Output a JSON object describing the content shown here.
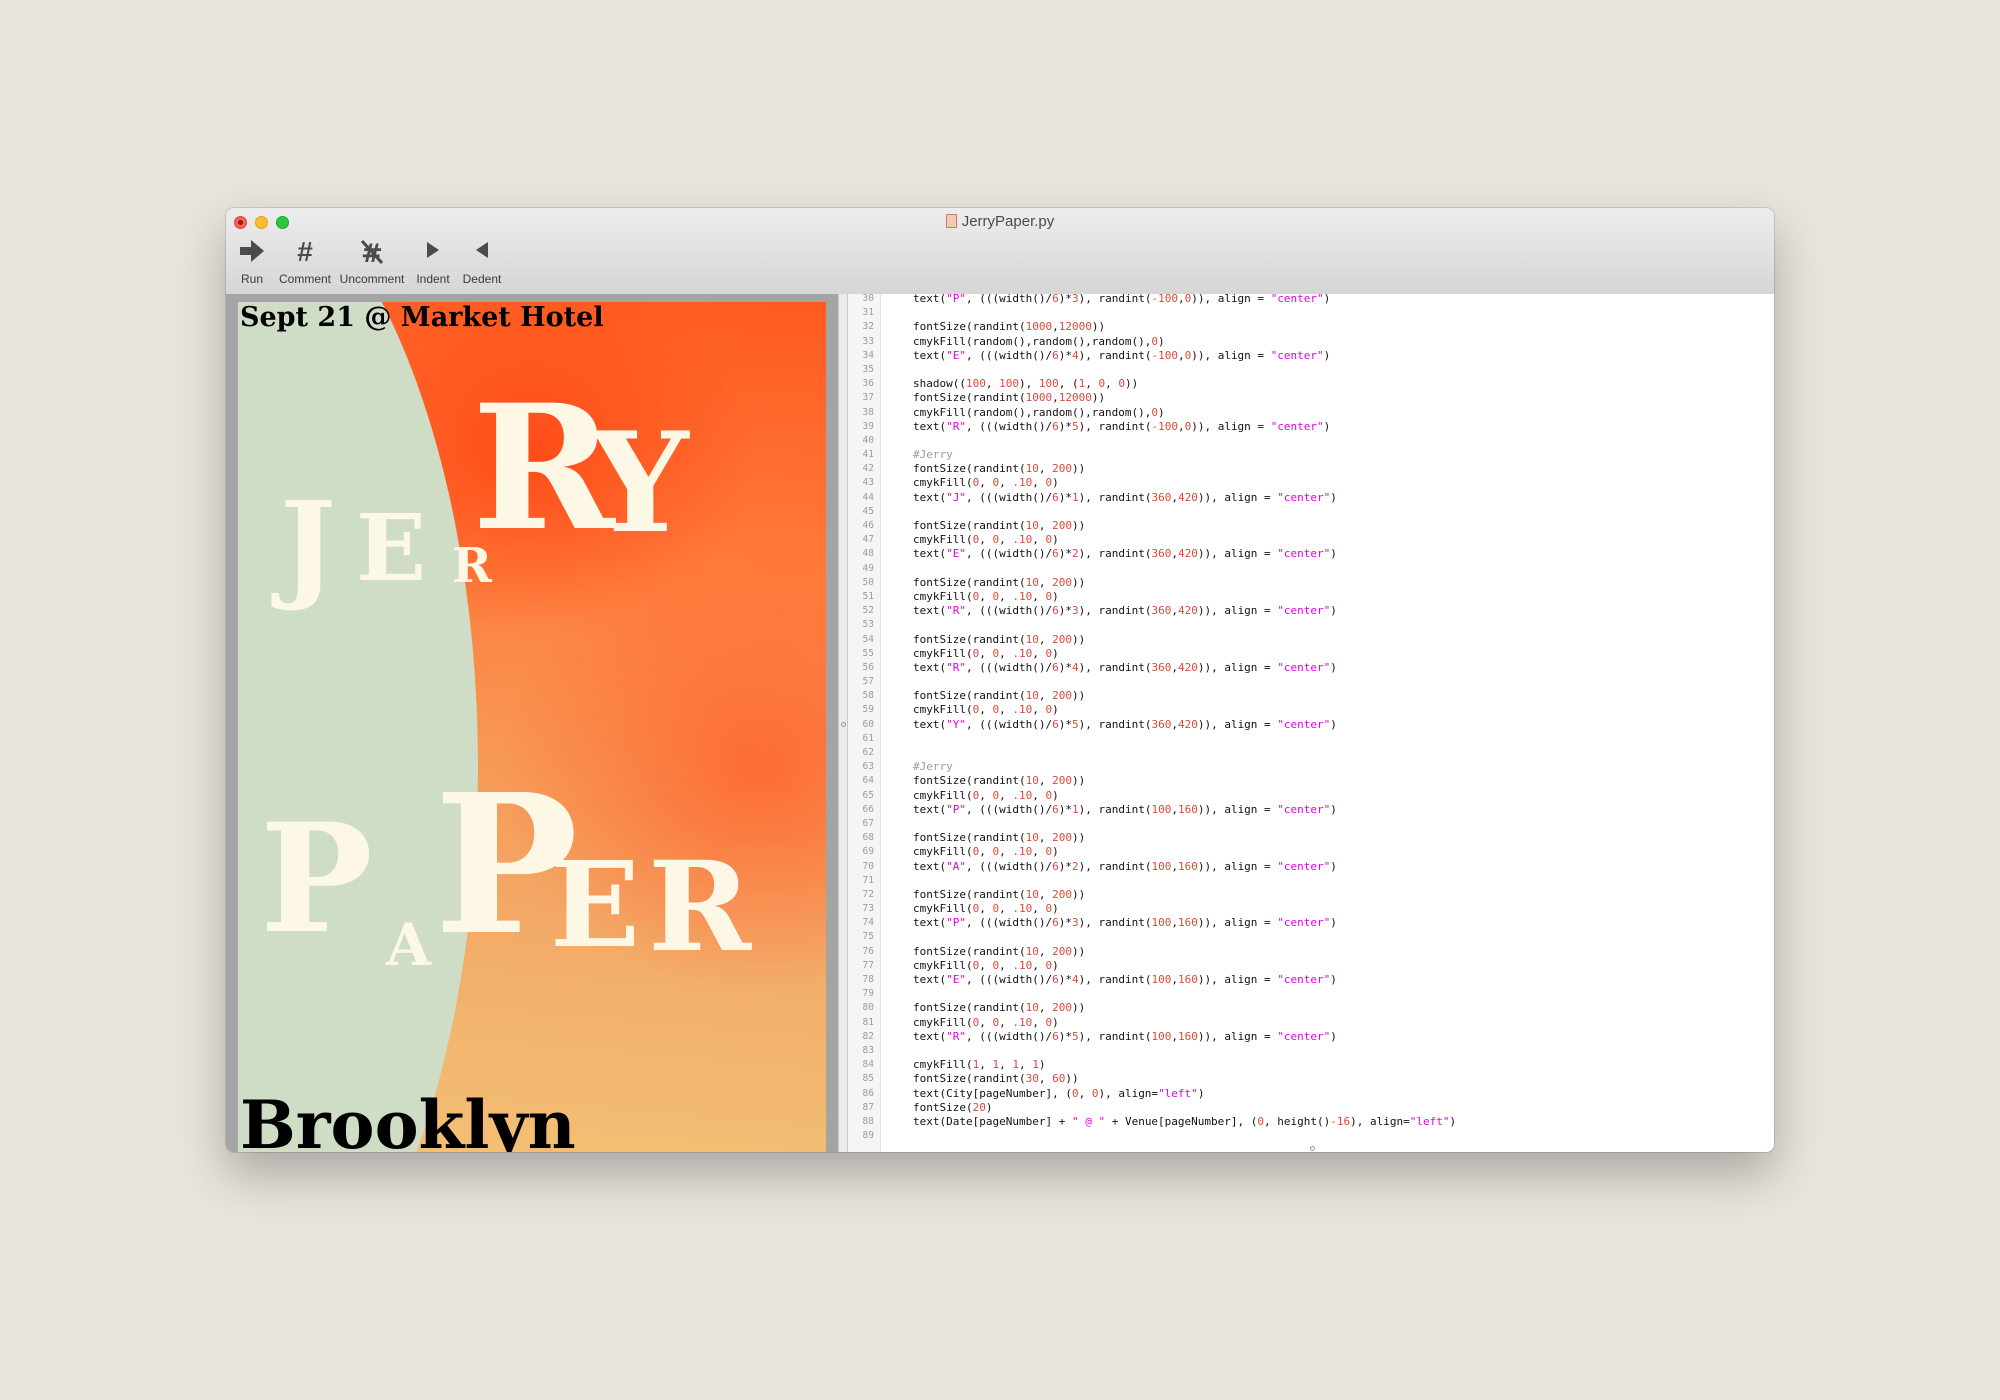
{
  "window": {
    "title": "JerryPaper.py"
  },
  "toolbar": {
    "run_label": "Run",
    "comment_label": "Comment",
    "uncomment_label": "Uncomment",
    "indent_label": "Indent",
    "dedent_label": "Dedent"
  },
  "poster": {
    "top_caption": "Sept 21 @ Market Hotel",
    "bottom_caption": "Brooklyn",
    "letters": [
      "J",
      "E",
      "R",
      "R",
      "Y",
      "P",
      "A",
      "P",
      "E",
      "R"
    ]
  },
  "colors": {
    "desktop": "#e9e5de",
    "poster_green": "#cfdcc6",
    "poster_orange": "#ff5a20",
    "poster_yellow": "#f3c174",
    "letter_cream": "#fdf7e6",
    "string_magenta": "#e500e5",
    "number_red": "#d84b3b"
  },
  "editor": {
    "lines": [
      {
        "n": "30",
        "text": "    text(\"P\", (((width()/6)*3), randint(-100,0)), align = \"center\")"
      },
      {
        "n": "31",
        "text": ""
      },
      {
        "n": "32",
        "text": "    fontSize(randint(1000,12000))"
      },
      {
        "n": "33",
        "text": "    cmykFill(random(),random(),random(),0)"
      },
      {
        "n": "34",
        "text": "    text(\"E\", (((width()/6)*4), randint(-100,0)), align = \"center\")"
      },
      {
        "n": "35",
        "text": ""
      },
      {
        "n": "36",
        "text": "    shadow((100, 100), 100, (1, 0, 0))"
      },
      {
        "n": "37",
        "text": "    fontSize(randint(1000,12000))"
      },
      {
        "n": "38",
        "text": "    cmykFill(random(),random(),random(),0)"
      },
      {
        "n": "39",
        "text": "    text(\"R\", (((width()/6)*5), randint(-100,0)), align = \"center\")"
      },
      {
        "n": "40",
        "text": ""
      },
      {
        "n": "41",
        "text": "    #Jerry"
      },
      {
        "n": "42",
        "text": "    fontSize(randint(10, 200))"
      },
      {
        "n": "43",
        "text": "    cmykFill(0, 0, .10, 0)"
      },
      {
        "n": "44",
        "text": "    text(\"J\", (((width()/6)*1), randint(360,420)), align = \"center\")"
      },
      {
        "n": "45",
        "text": ""
      },
      {
        "n": "46",
        "text": "    fontSize(randint(10, 200))"
      },
      {
        "n": "47",
        "text": "    cmykFill(0, 0, .10, 0)"
      },
      {
        "n": "48",
        "text": "    text(\"E\", (((width()/6)*2), randint(360,420)), align = \"center\")"
      },
      {
        "n": "49",
        "text": ""
      },
      {
        "n": "50",
        "text": "    fontSize(randint(10, 200))"
      },
      {
        "n": "51",
        "text": "    cmykFill(0, 0, .10, 0)"
      },
      {
        "n": "52",
        "text": "    text(\"R\", (((width()/6)*3), randint(360,420)), align = \"center\")"
      },
      {
        "n": "53",
        "text": ""
      },
      {
        "n": "54",
        "text": "    fontSize(randint(10, 200))"
      },
      {
        "n": "55",
        "text": "    cmykFill(0, 0, .10, 0)"
      },
      {
        "n": "56",
        "text": "    text(\"R\", (((width()/6)*4), randint(360,420)), align = \"center\")"
      },
      {
        "n": "57",
        "text": ""
      },
      {
        "n": "58",
        "text": "    fontSize(randint(10, 200))"
      },
      {
        "n": "59",
        "text": "    cmykFill(0, 0, .10, 0)"
      },
      {
        "n": "60",
        "text": "    text(\"Y\", (((width()/6)*5), randint(360,420)), align = \"center\")"
      },
      {
        "n": "61",
        "text": ""
      },
      {
        "n": "62",
        "text": ""
      },
      {
        "n": "63",
        "text": "    #Jerry"
      },
      {
        "n": "64",
        "text": "    fontSize(randint(10, 200))"
      },
      {
        "n": "65",
        "text": "    cmykFill(0, 0, .10, 0)"
      },
      {
        "n": "66",
        "text": "    text(\"P\", (((width()/6)*1), randint(100,160)), align = \"center\")"
      },
      {
        "n": "67",
        "text": ""
      },
      {
        "n": "68",
        "text": "    fontSize(randint(10, 200))"
      },
      {
        "n": "69",
        "text": "    cmykFill(0, 0, .10, 0)"
      },
      {
        "n": "70",
        "text": "    text(\"A\", (((width()/6)*2), randint(100,160)), align = \"center\")"
      },
      {
        "n": "71",
        "text": ""
      },
      {
        "n": "72",
        "text": "    fontSize(randint(10, 200))"
      },
      {
        "n": "73",
        "text": "    cmykFill(0, 0, .10, 0)"
      },
      {
        "n": "74",
        "text": "    text(\"P\", (((width()/6)*3), randint(100,160)), align = \"center\")"
      },
      {
        "n": "75",
        "text": ""
      },
      {
        "n": "76",
        "text": "    fontSize(randint(10, 200))"
      },
      {
        "n": "77",
        "text": "    cmykFill(0, 0, .10, 0)"
      },
      {
        "n": "78",
        "text": "    text(\"E\", (((width()/6)*4), randint(100,160)), align = \"center\")"
      },
      {
        "n": "79",
        "text": ""
      },
      {
        "n": "80",
        "text": "    fontSize(randint(10, 200))"
      },
      {
        "n": "81",
        "text": "    cmykFill(0, 0, .10, 0)"
      },
      {
        "n": "82",
        "text": "    text(\"R\", (((width()/6)*5), randint(100,160)), align = \"center\")"
      },
      {
        "n": "83",
        "text": ""
      },
      {
        "n": "84",
        "text": "    cmykFill(1, 1, 1, 1)"
      },
      {
        "n": "85",
        "text": "    fontSize(randint(30, 60))"
      },
      {
        "n": "86",
        "text": "    text(City[pageNumber], (0, 0), align=\"left\")"
      },
      {
        "n": "87",
        "text": "    fontSize(20)"
      },
      {
        "n": "88",
        "text": "    text(Date[pageNumber] + \" @ \" + Venue[pageNumber], (0, height()-16), align=\"left\")"
      },
      {
        "n": "89",
        "text": ""
      }
    ]
  }
}
